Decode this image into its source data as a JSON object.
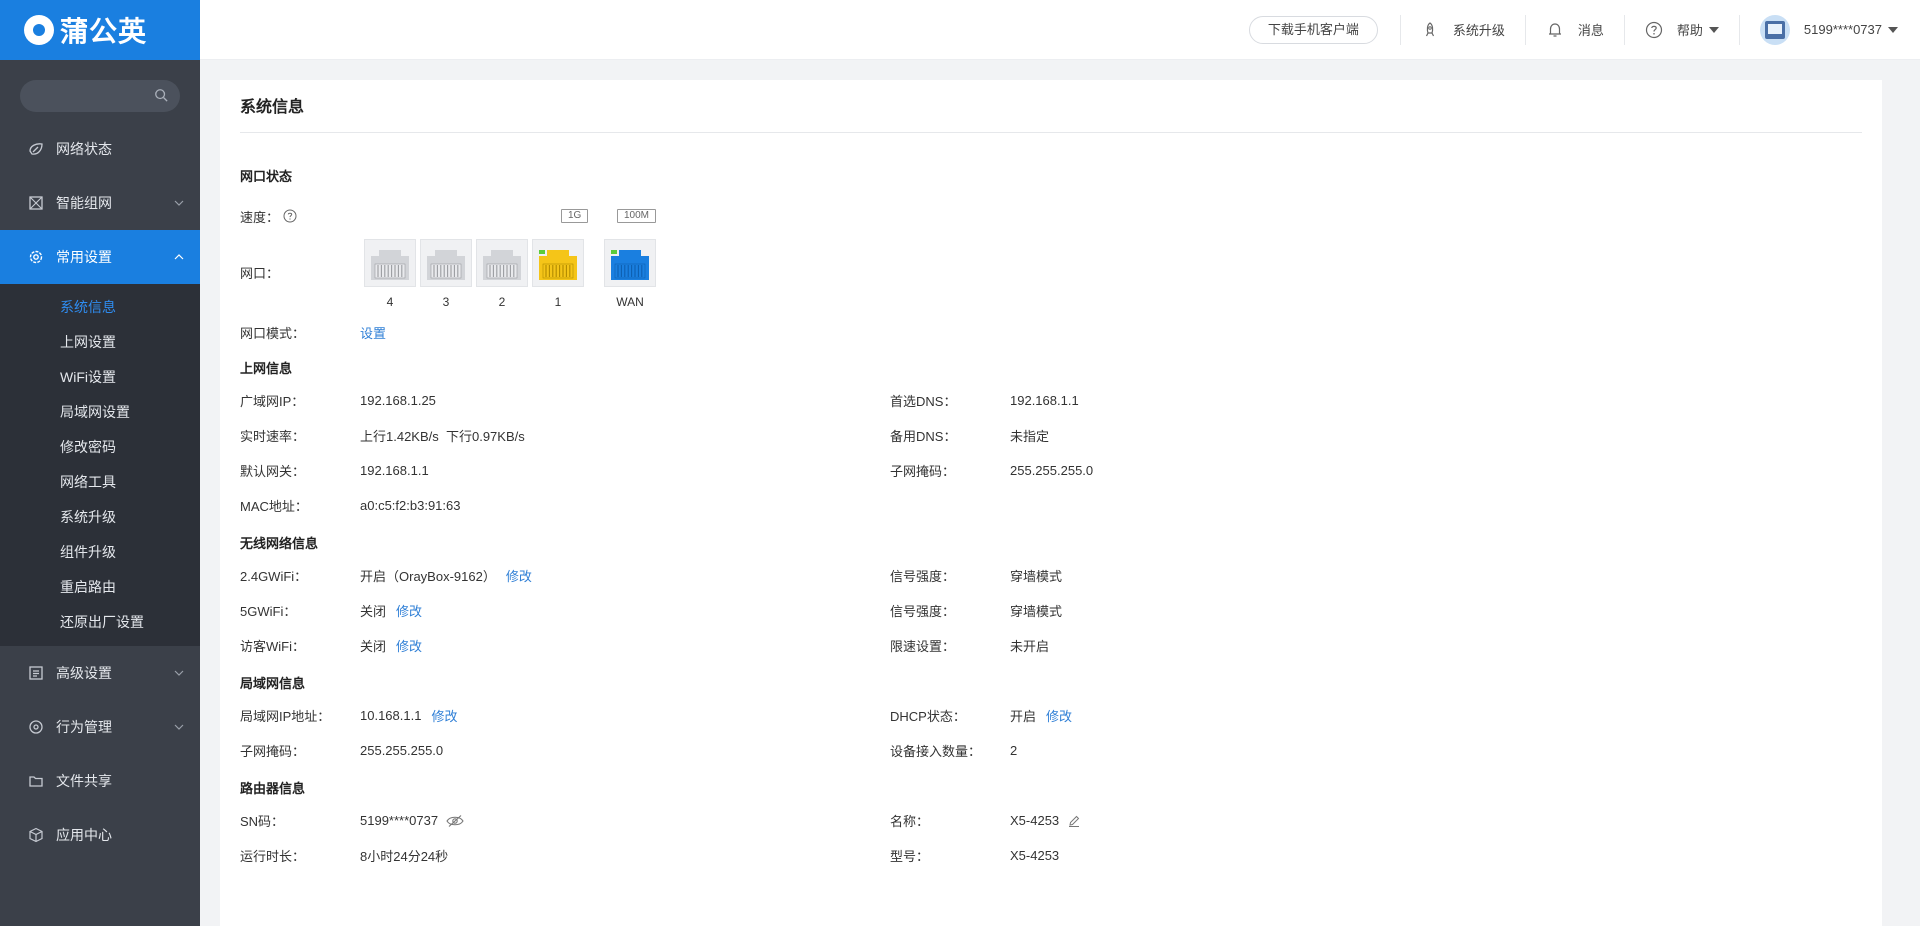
{
  "brand": "蒲公英",
  "search": {
    "placeholder": ""
  },
  "sidebar": {
    "items_top": [
      {
        "label": "网络状态",
        "icon": "network-status-icon"
      },
      {
        "label": "智能组网",
        "icon": "smart-network-icon"
      },
      {
        "label": "常用设置",
        "icon": "gear-icon",
        "active": true
      }
    ],
    "submenu": [
      "系统信息",
      "上网设置",
      "WiFi设置",
      "局域网设置",
      "修改密码",
      "网络工具",
      "系统升级",
      "组件升级",
      "重启路由",
      "还原出厂设置"
    ],
    "items_bottom": [
      {
        "label": "高级设置",
        "icon": "advanced-settings-icon"
      },
      {
        "label": "行为管理",
        "icon": "behavior-icon"
      },
      {
        "label": "文件共享",
        "icon": "folder-icon"
      },
      {
        "label": "应用中心",
        "icon": "cube-icon"
      }
    ]
  },
  "header": {
    "download_btn": "下载手机客户端",
    "upgrade": "系统升级",
    "messages": "消息",
    "help": "帮助",
    "user": "5199****0737"
  },
  "page": {
    "title": "系统信息",
    "port_section": "网口状态",
    "speed_label": "速度：",
    "port_label": "网口：",
    "speed_tags": [
      "1G",
      "100M"
    ],
    "ports": [
      {
        "name": "4",
        "status": "off",
        "color": "#e6e7ea"
      },
      {
        "name": "3",
        "status": "off",
        "color": "#e6e7ea"
      },
      {
        "name": "2",
        "status": "off",
        "color": "#e6e7ea"
      },
      {
        "name": "1",
        "status": "on",
        "color": "#f5c518"
      },
      {
        "name": "WAN",
        "status": "on",
        "color": "#1a7fe0"
      }
    ],
    "port_mode_label": "网口模式：",
    "port_mode_link": "设置",
    "internet": {
      "title": "上网信息",
      "wan_ip_label": "广域网IP：",
      "wan_ip": "192.168.1.25",
      "dns1_label": "首选DNS：",
      "dns1": "192.168.1.1",
      "rate_label": "实时速率：",
      "rate": "上行1.42KB/s  下行0.97KB/s",
      "dns2_label": "备用DNS：",
      "dns2": "未指定",
      "gw_label": "默认网关：",
      "gw": "192.168.1.1",
      "mask_label": "子网掩码：",
      "mask": "255.255.255.0",
      "mac_label": "MAC地址：",
      "mac": "a0:c5:f2:b3:91:63"
    },
    "wireless": {
      "title": "无线网络信息",
      "w24_label": "2.4GWiFi：",
      "w24": "开启（OrayBox-9162）",
      "sig1_label": "信号强度：",
      "sig1": "穿墙模式",
      "w5_label": "5GWiFi：",
      "w5": "关闭",
      "sig2_label": "信号强度：",
      "sig2": "穿墙模式",
      "guest_label": "访客WiFi：",
      "guest": "关闭",
      "limit_label": "限速设置：",
      "limit": "未开启",
      "modify": "修改"
    },
    "lan": {
      "title": "局域网信息",
      "ip_label": "局域网IP地址：",
      "ip": "10.168.1.1",
      "dhcp_label": "DHCP状态：",
      "dhcp": "开启",
      "mask_label": "子网掩码：",
      "mask": "255.255.255.0",
      "dev_label": "设备接入数量：",
      "dev": "2",
      "modify": "修改"
    },
    "router": {
      "title": "路由器信息",
      "sn_label": "SN码：",
      "sn": "5199****0737",
      "name_label": "名称：",
      "name": "X5-4253",
      "uptime_label": "运行时长：",
      "uptime": "8小时24分24秒",
      "model_label": "型号：",
      "model": "X5-4253"
    }
  }
}
